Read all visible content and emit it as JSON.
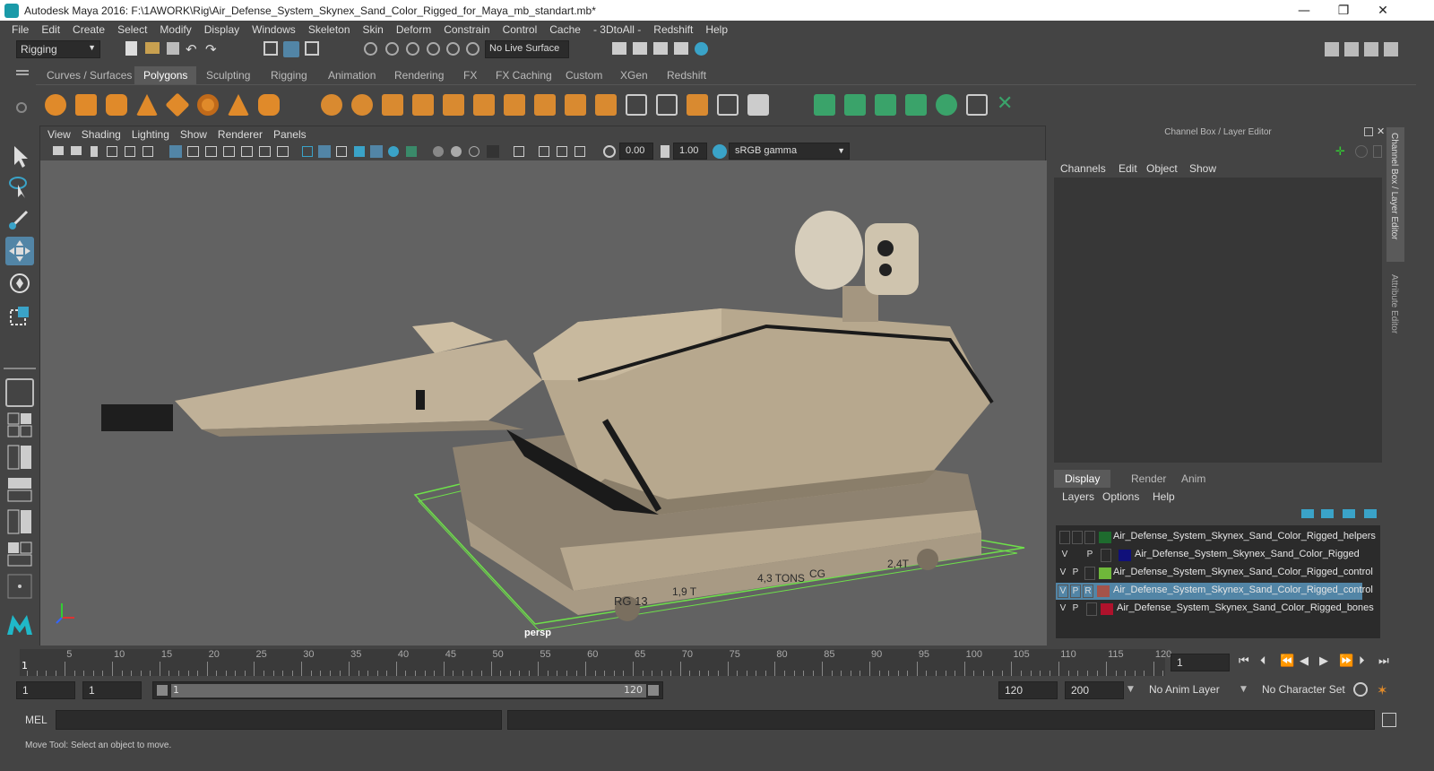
{
  "window": {
    "title": "Autodesk Maya 2016: F:\\1AWORK\\Rig\\Air_Defense_System_Skynex_Sand_Color_Rigged_for_Maya_mb_standart.mb*",
    "minimize": "—",
    "maximize": "❐",
    "close": "✕"
  },
  "menubar": [
    "File",
    "Edit",
    "Create",
    "Select",
    "Modify",
    "Display",
    "Windows",
    "Skeleton",
    "Skin",
    "Deform",
    "Constrain",
    "Control",
    "Cache",
    "- 3DtoAll -",
    "Redshift",
    "Help"
  ],
  "statusline": {
    "menuset": "Rigging",
    "live_surface": "No Live Surface"
  },
  "shelf": {
    "tabs": [
      "Curves / Surfaces",
      "Polygons",
      "Sculpting",
      "Rigging",
      "Animation",
      "Rendering",
      "FX",
      "FX Caching",
      "Custom",
      "XGen",
      "Redshift"
    ],
    "active_tab": "Polygons"
  },
  "viewport": {
    "menus": [
      "View",
      "Shading",
      "Lighting",
      "Show",
      "Renderer",
      "Panels"
    ],
    "exposure": "0.00",
    "gamma": "1.00",
    "color_space": "sRGB gamma",
    "camera_label": "persp",
    "model_text": {
      "rg": "RG 13",
      "weight1": "1,9 T",
      "weight2": "4,3 TONS",
      "cg": "CG",
      "weight3": "2,4T"
    }
  },
  "channel_box": {
    "title": "Channel Box / Layer Editor",
    "menus": [
      "Channels",
      "Edit",
      "Object",
      "Show"
    ],
    "side_tabs": [
      "Channel Box / Layer Editor",
      "Attribute Editor"
    ]
  },
  "layer_editor": {
    "tabs": [
      "Display",
      "Render",
      "Anim"
    ],
    "active_tab": "Display",
    "menus": [
      "Layers",
      "Options",
      "Help"
    ],
    "layers": [
      {
        "v": "",
        "p": "",
        "r": "",
        "color": "#1e6b2e",
        "name": "Air_Defense_System_Skynex_Sand_Color_Rigged_helpers",
        "selected": false
      },
      {
        "v": "V",
        "p": "P",
        "r": "",
        "color": "#10107a",
        "name": "Air_Defense_System_Skynex_Sand_Color_Rigged",
        "selected": false
      },
      {
        "v": "V",
        "p": "P",
        "r": "",
        "color": "#6fb83a",
        "name": "Air_Defense_System_Skynex_Sand_Color_Rigged_control",
        "selected": false
      },
      {
        "v": "V",
        "p": "P",
        "r": "R",
        "color": "#a4534a",
        "name": "Air_Defense_System_Skynex_Sand_Color_Rigged_control",
        "selected": true
      },
      {
        "v": "V",
        "p": "P",
        "r": "",
        "color": "#b0122c",
        "name": "Air_Defense_System_Skynex_Sand_Color_Rigged_bones",
        "selected": false
      }
    ]
  },
  "timeline": {
    "ticks": [
      "5",
      "10",
      "15",
      "20",
      "25",
      "30",
      "35",
      "40",
      "45",
      "50",
      "55",
      "60",
      "65",
      "70",
      "75",
      "80",
      "85",
      "90",
      "95",
      "100",
      "105",
      "110",
      "115",
      "120"
    ],
    "current_frame_marker": "1",
    "current_frame": "1"
  },
  "range": {
    "start": "1",
    "playback_start": "1",
    "slider_start": "1",
    "slider_end": "120",
    "playback_end": "120",
    "end": "200",
    "anim_layer": "No Anim Layer",
    "character_set": "No Character Set"
  },
  "mel": {
    "label": "MEL"
  },
  "help_line": "Move Tool: Select an object to move.",
  "colors": {
    "selection": "#5285a6",
    "accent_teal": "#1a9aa8",
    "grid_green": "#6ee04a"
  }
}
